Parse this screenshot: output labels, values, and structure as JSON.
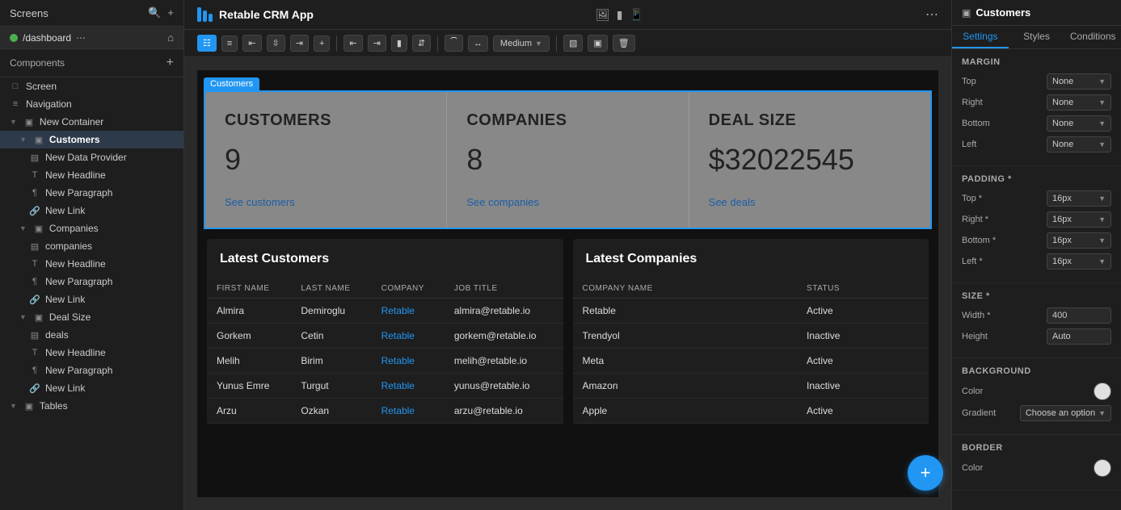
{
  "app": {
    "title": "Retable CRM App"
  },
  "left_sidebar": {
    "top_title": "Screens",
    "screen_name": "/dashboard",
    "components_label": "Components",
    "tree_items": [
      {
        "id": "screen",
        "label": "Screen",
        "indent": 0,
        "type": "screen"
      },
      {
        "id": "navigation",
        "label": "Navigation",
        "indent": 0,
        "type": "nav"
      },
      {
        "id": "new-container",
        "label": "New Container",
        "indent": 0,
        "type": "container"
      },
      {
        "id": "customers",
        "label": "Customers",
        "indent": 1,
        "type": "container",
        "selected": true
      },
      {
        "id": "new-data-provider",
        "label": "New Data Provider",
        "indent": 2,
        "type": "data"
      },
      {
        "id": "new-headline-1",
        "label": "New Headline",
        "indent": 2,
        "type": "text"
      },
      {
        "id": "new-paragraph-1",
        "label": "New Paragraph",
        "indent": 2,
        "type": "para"
      },
      {
        "id": "new-link-1",
        "label": "New Link",
        "indent": 2,
        "type": "link"
      },
      {
        "id": "companies",
        "label": "Companies",
        "indent": 1,
        "type": "container"
      },
      {
        "id": "companies-data",
        "label": "companies",
        "indent": 2,
        "type": "data"
      },
      {
        "id": "new-headline-2",
        "label": "New Headline",
        "indent": 2,
        "type": "text"
      },
      {
        "id": "new-paragraph-2",
        "label": "New Paragraph",
        "indent": 2,
        "type": "para"
      },
      {
        "id": "new-link-2",
        "label": "New Link",
        "indent": 2,
        "type": "link"
      },
      {
        "id": "deal-size",
        "label": "Deal Size",
        "indent": 1,
        "type": "container"
      },
      {
        "id": "deals",
        "label": "deals",
        "indent": 2,
        "type": "data"
      },
      {
        "id": "new-headline-3",
        "label": "New Headline",
        "indent": 2,
        "type": "text"
      },
      {
        "id": "new-paragraph-3",
        "label": "New Paragraph",
        "indent": 2,
        "type": "para"
      },
      {
        "id": "new-link-3",
        "label": "New Link",
        "indent": 2,
        "type": "link"
      },
      {
        "id": "tables",
        "label": "Tables",
        "indent": 0,
        "type": "container"
      }
    ]
  },
  "toolbar": {
    "medium_label": "Medium",
    "buttons": [
      "grid1",
      "grid2",
      "align-left",
      "align-center",
      "align-right",
      "plus",
      "col-left",
      "col-right",
      "bar-chart",
      "align-v",
      "curve",
      "expand",
      "layout",
      "copy",
      "trash"
    ]
  },
  "stats": [
    {
      "id": "customers",
      "title": "CUSTOMERS",
      "value": "9",
      "link": "See customers"
    },
    {
      "id": "companies",
      "title": "COMPANIES",
      "value": "8",
      "link": "See companies"
    },
    {
      "id": "deal-size",
      "title": "DEAL SIZE",
      "value": "$32022545",
      "link": "See deals"
    }
  ],
  "latest_customers": {
    "title": "Latest Customers",
    "columns": [
      "FIRST NAME",
      "LAST NAME",
      "COMPANY",
      "JOB TITLE"
    ],
    "rows": [
      {
        "first": "Almira",
        "last": "Demiroglu",
        "company": "Retable",
        "job": "almira@retable.io"
      },
      {
        "first": "Gorkem",
        "last": "Cetin",
        "company": "Retable",
        "job": "gorkem@retable.io"
      },
      {
        "first": "Melih",
        "last": "Birim",
        "company": "Retable",
        "job": "melih@retable.io"
      },
      {
        "first": "Yunus Emre",
        "last": "Turgut",
        "company": "Retable",
        "job": "yunus@retable.io"
      },
      {
        "first": "Arzu",
        "last": "Ozkan",
        "company": "Retable",
        "job": "arzu@retable.io"
      }
    ]
  },
  "latest_companies": {
    "title": "Latest Companies",
    "columns": [
      "COMPANY NAME",
      "STATUS"
    ],
    "rows": [
      {
        "name": "Retable",
        "status": "Active",
        "active": true
      },
      {
        "name": "Trendyol",
        "status": "Inactive",
        "active": false
      },
      {
        "name": "Meta",
        "status": "Active",
        "active": true
      },
      {
        "name": "Amazon",
        "status": "Inactive",
        "active": false
      },
      {
        "name": "Apple",
        "status": "Active",
        "active": true
      }
    ]
  },
  "right_panel": {
    "title": "Customers",
    "tabs": [
      "Settings",
      "Styles",
      "Conditions"
    ],
    "active_tab": "Settings",
    "margin": {
      "label": "MARGIN",
      "fields": [
        {
          "label": "Top",
          "value": "None"
        },
        {
          "label": "Right",
          "value": "None"
        },
        {
          "label": "Bottom",
          "value": "None"
        },
        {
          "label": "Left",
          "value": "None"
        }
      ]
    },
    "padding": {
      "label": "PADDING *",
      "fields": [
        {
          "label": "Top *",
          "value": "16px"
        },
        {
          "label": "Right *",
          "value": "16px"
        },
        {
          "label": "Bottom *",
          "value": "16px"
        },
        {
          "label": "Left *",
          "value": "16px"
        }
      ]
    },
    "size": {
      "label": "SIZE *",
      "width_label": "Width *",
      "width_value": "400",
      "height_label": "Height",
      "height_value": "Auto"
    },
    "background": {
      "label": "BACKGROUND",
      "color_label": "Color",
      "gradient_label": "Gradient",
      "gradient_value": "Choose an option"
    },
    "border": {
      "label": "BORDER",
      "color_label": "Color"
    }
  }
}
